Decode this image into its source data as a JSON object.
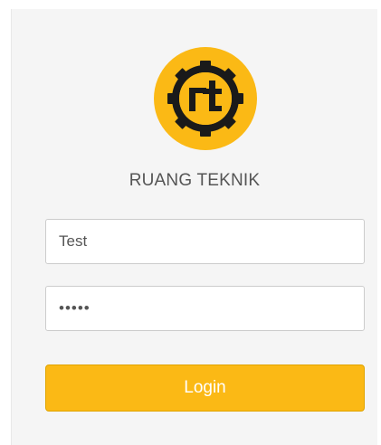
{
  "brand": {
    "name": "RUANG TEKNIK",
    "logo_icon": "gear-rt-logo-icon",
    "logo_color": "#fbb915"
  },
  "form": {
    "username_value": "Test",
    "password_value": "abcde",
    "login_label": "Login"
  },
  "colors": {
    "accent": "#fbb915",
    "card_background": "#f5f5f5",
    "text": "#555555"
  }
}
